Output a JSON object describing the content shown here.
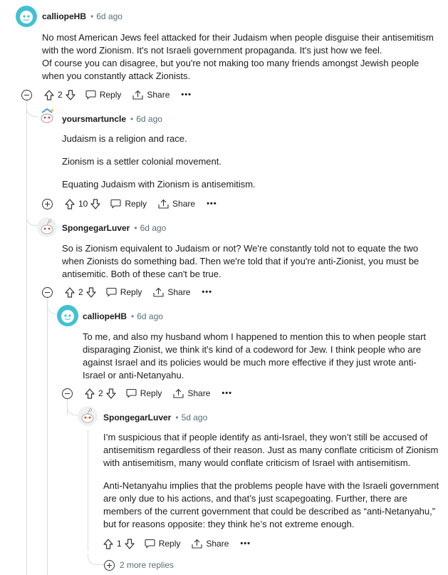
{
  "comments": [
    {
      "user": "calliopeHB",
      "time": "6d ago",
      "paragraphs": [
        "No most American Jews feel attacked for their Judaism when people disguise their antisemitism with the word Zionism. It's not Israeli government propaganda. It's just how we feel.\nOf course you can disagree, but you're not making too many friends amongst Jewish people when you constantly attack Zionists."
      ],
      "votes": "2",
      "reply": "Reply",
      "share": "Share",
      "more": "•••",
      "collapsed": false
    },
    {
      "user": "yoursmartuncle",
      "time": "6d ago",
      "paragraphs": [
        "Judaism is a religion and race.",
        "Zionism is a settler colonial movement.",
        "Equating Judaism with Zionism is antisemitism."
      ],
      "votes": "10",
      "reply": "Reply",
      "share": "Share",
      "more": "•••",
      "collapsed": true
    },
    {
      "user": "SpongegarLuver",
      "time": "6d ago",
      "paragraphs": [
        "So is Zionism equivalent to Judaism or not? We're constantly told not to equate the two when Zionists do something bad. Then we're told that if you're anti-Zionist, you must be antisemitic. Both of these can't be true."
      ],
      "votes": "2",
      "reply": "Reply",
      "share": "Share",
      "more": "•••",
      "collapsed": false
    },
    {
      "user": "calliopeHB",
      "time": "6d ago",
      "paragraphs": [
        "To me, and also my husband whom I happened to mention this to when people start disparaging Zionist, we think it's kind of a codeword for Jew. I think people who are against Israel and its policies would be much more effective if they just wrote anti-Israel or anti-Netanyahu."
      ],
      "votes": "2",
      "reply": "Reply",
      "share": "Share",
      "more": "•••",
      "collapsed": false
    },
    {
      "user": "SpongegarLuver",
      "time": "5d ago",
      "paragraphs": [
        "I’m suspicious that if people identify as anti-Israel, they won’t still be accused of antisemitism regardless of their reason. Just as many conflate criticism of Zionism with antisemitism, many would conflate criticism of Israel with antisemitism.",
        "Anti-Netanyahu implies that the problems people have with the Israeli government are only due to his actions, and that’s just scapegoating. Further, there are members of the current government that could be described as “anti-Netanyahu,” but for reasons opposite: they think he’s not extreme enough."
      ],
      "votes": "1",
      "reply": "Reply",
      "share": "Share",
      "more": "•••",
      "collapsed": false
    }
  ],
  "more_replies": "2 more replies",
  "icons": {
    "upvote": "arrow-up-icon",
    "downvote": "arrow-down-icon",
    "reply": "speech-bubble-icon",
    "share": "share-icon",
    "collapse": "minus-circle-icon",
    "expand": "plus-circle-icon"
  },
  "colors": {
    "avatar_teal": "#43c0d3",
    "thread_line": "#d9dde0",
    "meta_gray": "#576f76"
  }
}
